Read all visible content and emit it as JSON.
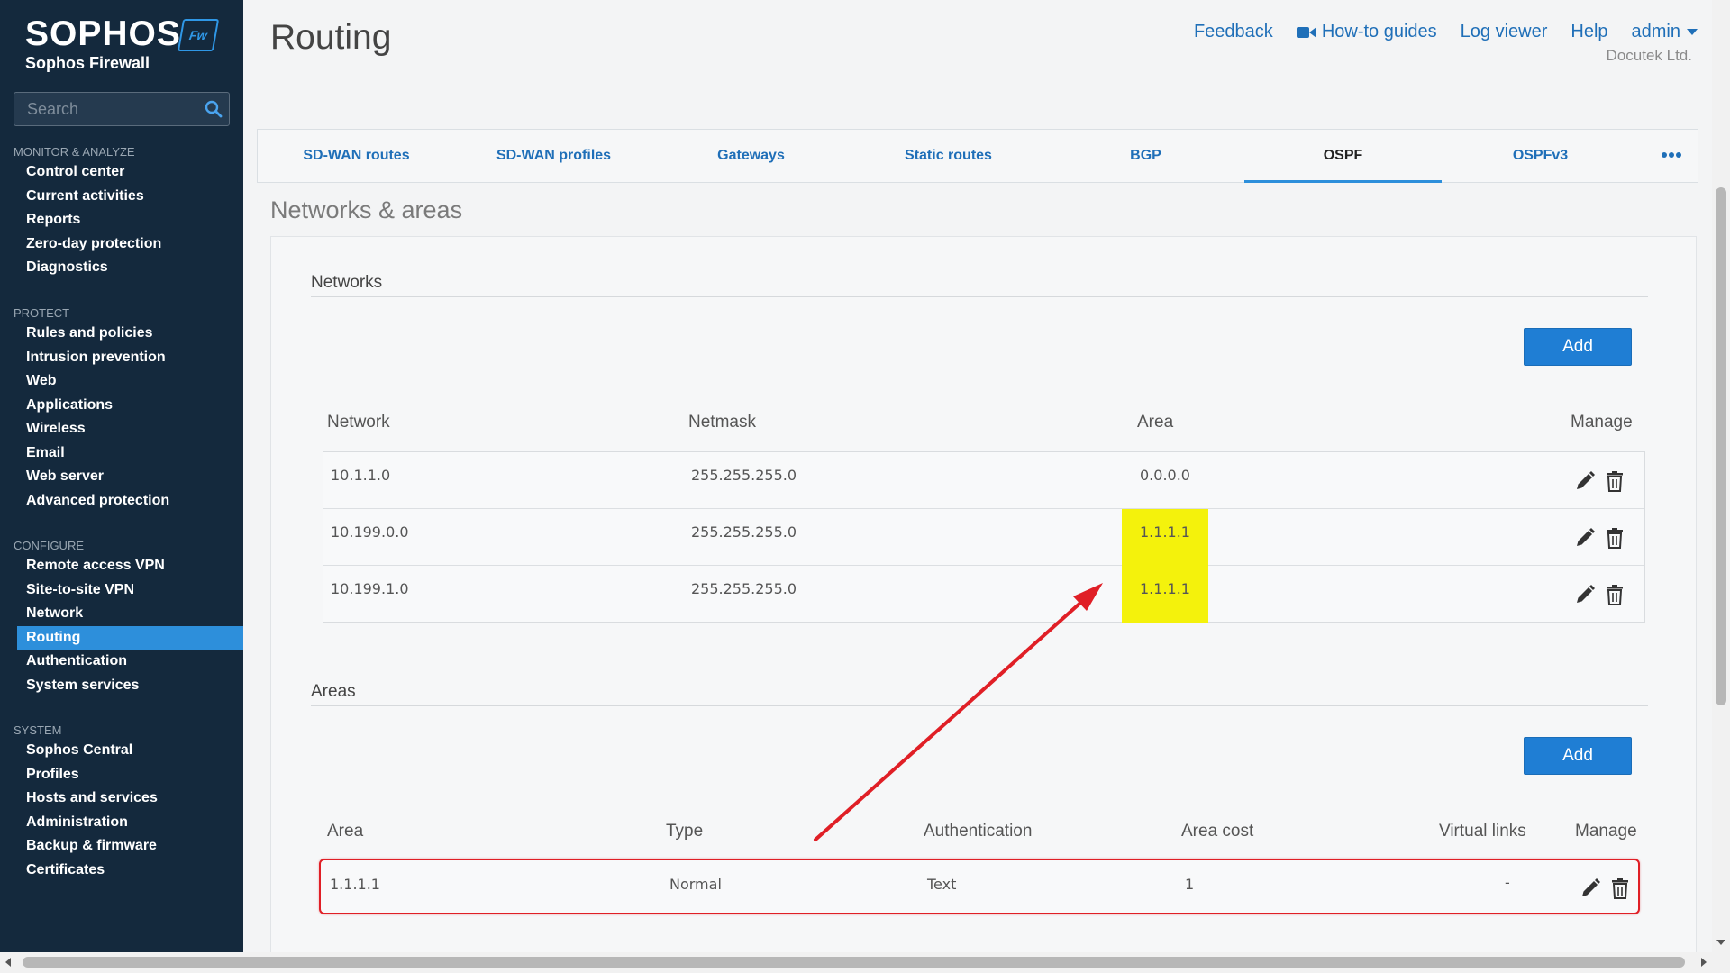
{
  "brand": {
    "name": "SOPHOS",
    "badge": "Fw",
    "product": "Sophos Firewall"
  },
  "search": {
    "placeholder": "Search"
  },
  "nav": {
    "monitor": {
      "heading": "MONITOR & ANALYZE",
      "items": [
        "Control center",
        "Current activities",
        "Reports",
        "Zero-day protection",
        "Diagnostics"
      ]
    },
    "protect": {
      "heading": "PROTECT",
      "items": [
        "Rules and policies",
        "Intrusion prevention",
        "Web",
        "Applications",
        "Wireless",
        "Email",
        "Web server",
        "Advanced protection"
      ]
    },
    "configure": {
      "heading": "CONFIGURE",
      "items": [
        "Remote access VPN",
        "Site-to-site VPN",
        "Network",
        "Routing",
        "Authentication",
        "System services"
      ]
    },
    "system": {
      "heading": "SYSTEM",
      "items": [
        "Sophos Central",
        "Profiles",
        "Hosts and services",
        "Administration",
        "Backup & firmware",
        "Certificates"
      ]
    },
    "active_item": "Routing"
  },
  "header": {
    "title": "Routing",
    "links": {
      "feedback": "Feedback",
      "howto": "How-to guides",
      "logviewer": "Log viewer",
      "help": "Help",
      "user": "admin"
    },
    "org": "Docutek Ltd."
  },
  "tabs": [
    "SD-WAN routes",
    "SD-WAN profiles",
    "Gateways",
    "Static routes",
    "BGP",
    "OSPF",
    "OSPFv3"
  ],
  "active_tab": "OSPF",
  "section": {
    "title": "Networks & areas",
    "networks": {
      "title": "Networks",
      "add_label": "Add",
      "columns": {
        "network": "Network",
        "netmask": "Netmask",
        "area": "Area",
        "manage": "Manage"
      },
      "rows": [
        {
          "network": "10.1.1.0",
          "netmask": "255.255.255.0",
          "area": "0.0.0.0"
        },
        {
          "network": "10.199.0.0",
          "netmask": "255.255.255.0",
          "area": "1.1.1.1"
        },
        {
          "network": "10.199.1.0",
          "netmask": "255.255.255.0",
          "area": "1.1.1.1"
        }
      ]
    },
    "areas": {
      "title": "Areas",
      "add_label": "Add",
      "columns": {
        "area": "Area",
        "type": "Type",
        "authentication": "Authentication",
        "area_cost": "Area cost",
        "virtual_links": "Virtual links",
        "manage": "Manage"
      },
      "rows": [
        {
          "area": "1.1.1.1",
          "type": "Normal",
          "authentication": "Text",
          "area_cost": "1",
          "virtual_links": "-"
        }
      ]
    }
  },
  "colors": {
    "sidebar": "#14293d",
    "accent": "#2d8fdb",
    "link": "#1f6fb8",
    "highlight": "#f4f20c",
    "annotation": "#e01f26"
  }
}
